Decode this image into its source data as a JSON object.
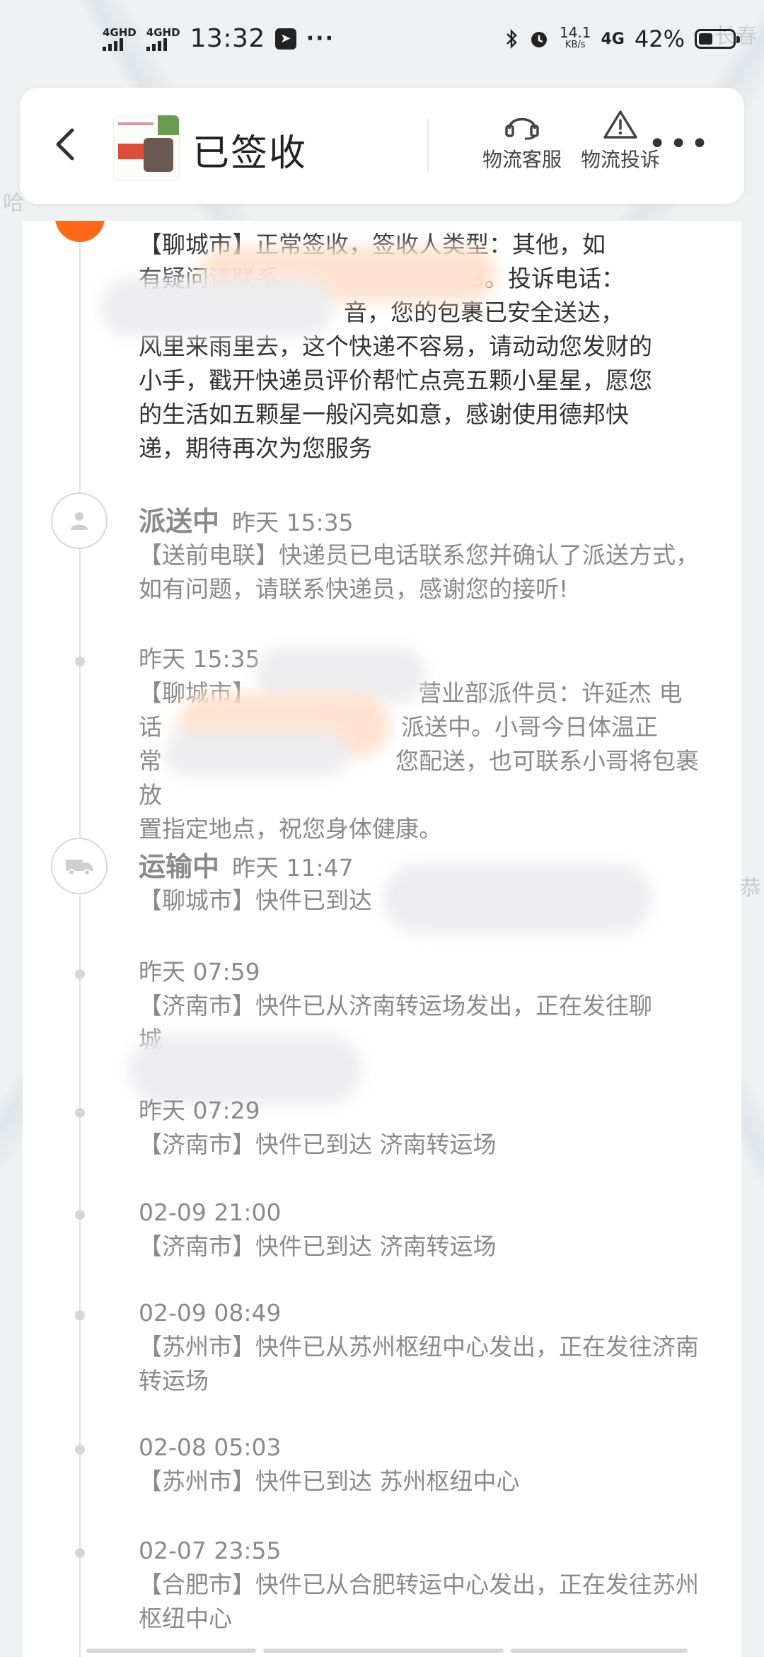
{
  "status_bar": {
    "sig1_label": "4GHD",
    "sig2_label": "4GHD",
    "time": "13:32",
    "telegram_glyph": "➤",
    "more": "···",
    "net_speed_value": "14.1",
    "net_speed_unit": "KB/s",
    "net_type": "4G",
    "battery_percent": "42%",
    "battery_level": 0.42
  },
  "map": {
    "label_top_right": "长春",
    "label_left": "哈",
    "label_right": "恭"
  },
  "header": {
    "title": "已签收",
    "service_label": "物流客服",
    "complaint_label": "物流投诉",
    "more_label": "•••",
    "accent": "#ff6a1a"
  },
  "timeline": {
    "signed": {
      "line1": "【聊城市】正常签收，签收人类型：其他，如",
      "line2_a": "有疑问请联系",
      "line2_hl": "3",
      "line2_b": "。投诉电话：",
      "line3": "音，您的包裹已安全送达，",
      "line4": "风里来雨里去，这个快递不容易，请动动您发财的",
      "line5": "小手，戳开快递员评价帮忙点亮五颗小星星，愿您",
      "line6": "的生活如五颗星一般闪亮如意，感谢使用德邦快",
      "line7": "递，期待再次为您服务"
    },
    "delivering": {
      "status": "派送中",
      "time": "昨天 15:35",
      "text": "【送前电联】快递员已电话联系您并确认了派送方式，如有问题，请联系快递员，感谢您的接听!"
    },
    "delivering2": {
      "time": "昨天 15:35",
      "line1_a": "【聊城市】",
      "line1_b": "营业部派件员：许延杰 电",
      "line2_a": "话",
      "line2_b": "派送中。小哥今日体温正",
      "line3_a": "常",
      "line3_b": "您配送，也可联系小哥将包裹放",
      "line4": "置指定地点，祝您身体健康。"
    },
    "transit": {
      "status": "运输中",
      "time": "昨天 11:47",
      "text": "【聊城市】快件已到达"
    },
    "e1": {
      "time": "昨天 07:59",
      "line1": "【济南市】快件已从济南转运场发出，正在发往聊",
      "line2": "城"
    },
    "e2": {
      "time": "昨天 07:29",
      "text": "【济南市】快件已到达 济南转运场"
    },
    "e3": {
      "time": "02-09 21:00",
      "text": "【济南市】快件已到达 济南转运场"
    },
    "e4": {
      "time": "02-09 08:49",
      "text": "【苏州市】快件已从苏州枢纽中心发出，正在发往济南转运场"
    },
    "e5": {
      "time": "02-08 05:03",
      "text": "【苏州市】快件已到达 苏州枢纽中心"
    },
    "e6": {
      "time": "02-07 23:55",
      "text": "【合肥市】快件已从合肥转运中心发出，正在发往苏州枢纽中心"
    }
  }
}
